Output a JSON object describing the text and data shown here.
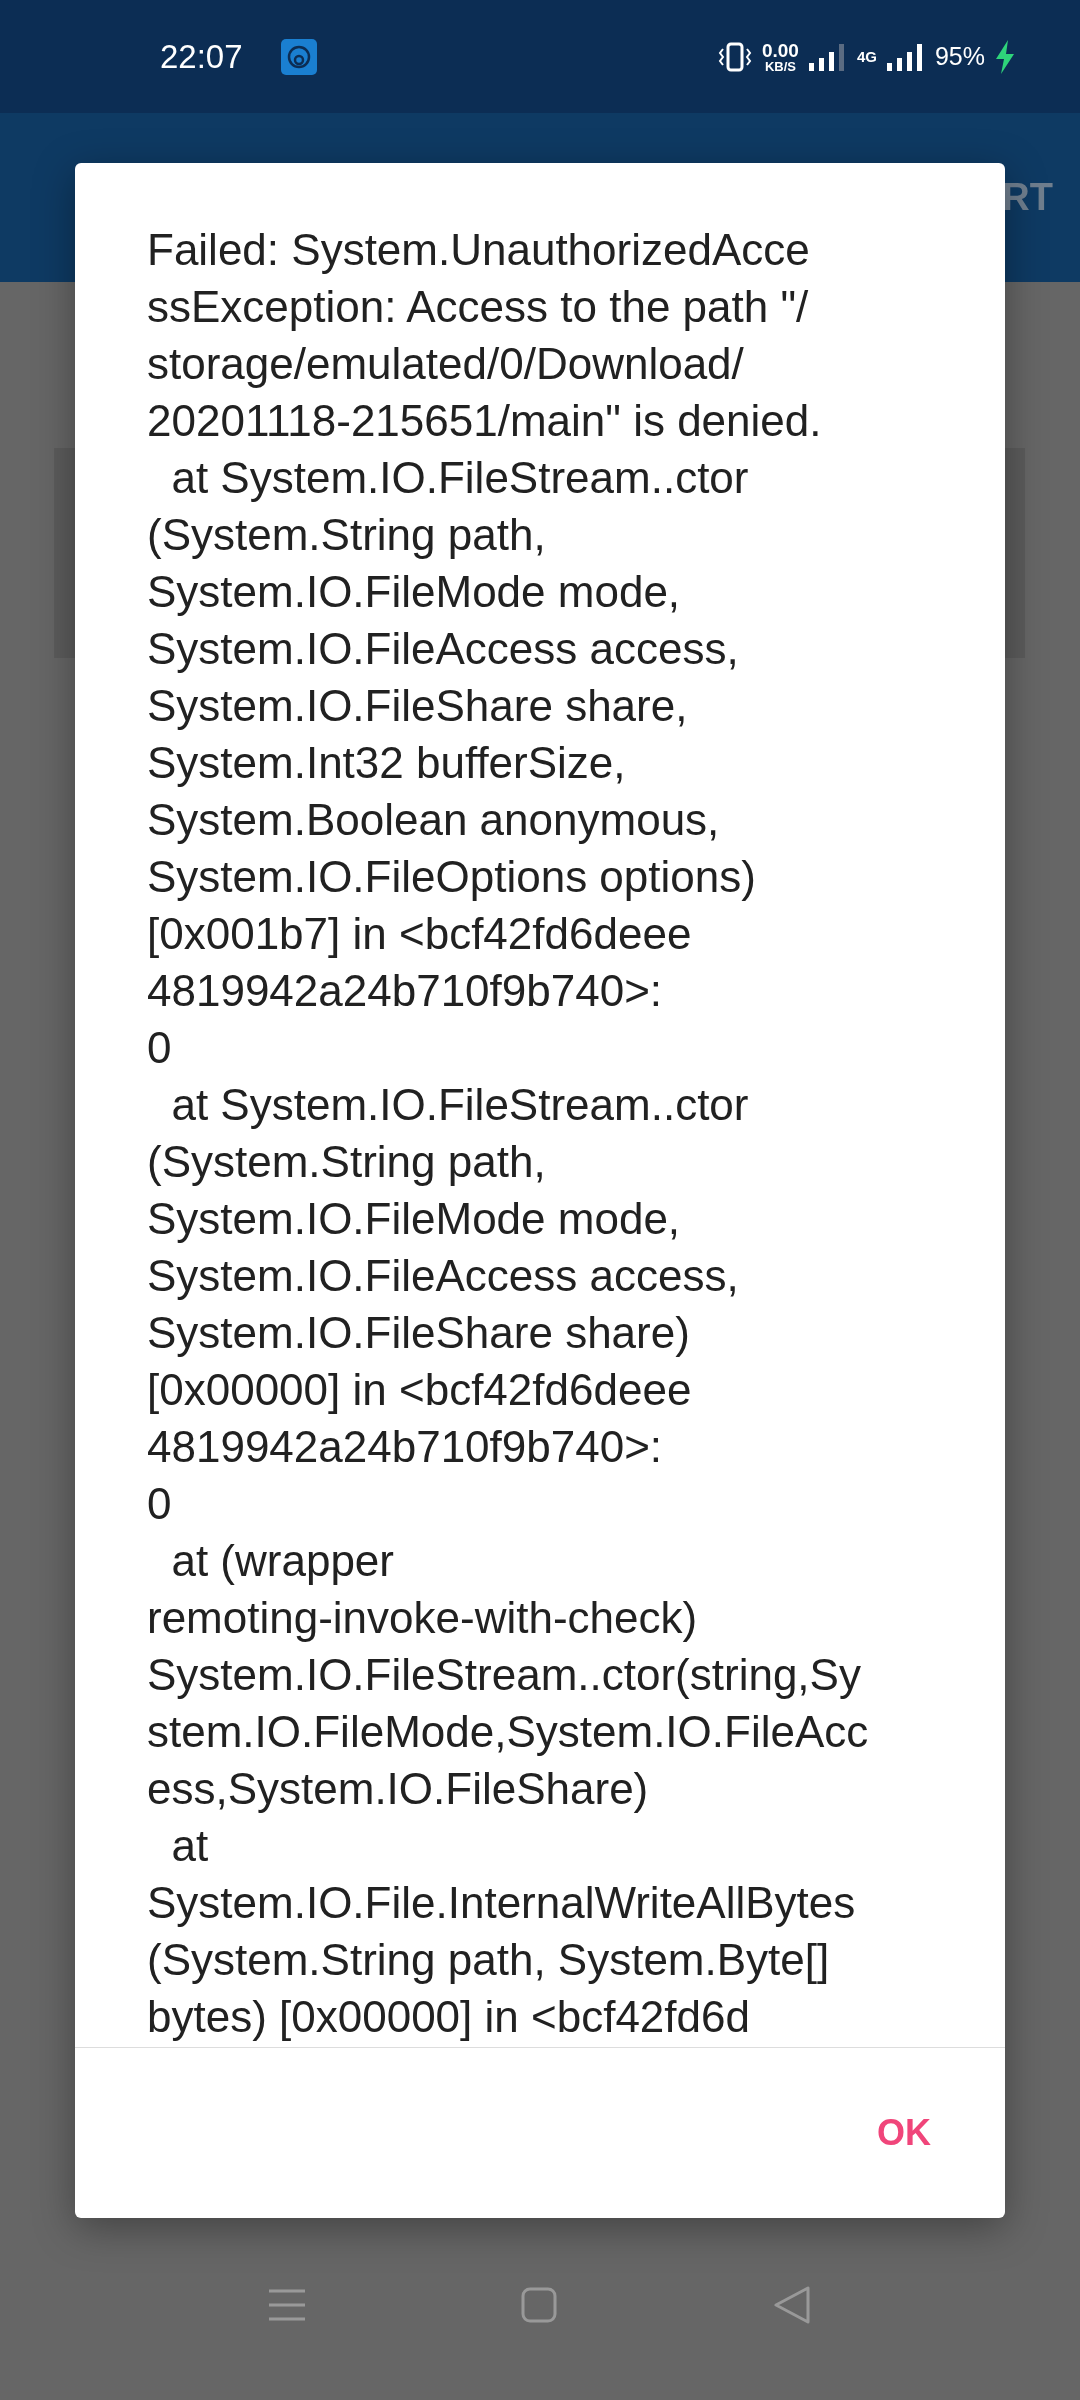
{
  "status_bar": {
    "time": "22:07",
    "net_speed": "0.00",
    "net_unit": "KB/S",
    "network_type": "4G",
    "battery": "95%"
  },
  "app_bar": {
    "action": "RT"
  },
  "dialog": {
    "message": "Failed: System.UnauthorizedAcce\nssException: Access to the path \"/\nstorage/emulated/0/Download/\n20201118-215651/main\" is denied.\n  at System.IO.FileStream..ctor\n(System.String path,\nSystem.IO.FileMode mode,\nSystem.IO.FileAccess access,\nSystem.IO.FileShare share,\nSystem.Int32 bufferSize,\nSystem.Boolean anonymous,\nSystem.IO.FileOptions options)\n[0x001b7] in <bcf42fd6deee\n4819942a24b710f9b740>:\n0\n  at System.IO.FileStream..ctor\n(System.String path,\nSystem.IO.FileMode mode,\nSystem.IO.FileAccess access,\nSystem.IO.FileShare share)\n[0x00000] in <bcf42fd6deee\n4819942a24b710f9b740>:\n0\n  at (wrapper\nremoting-invoke-with-check)\nSystem.IO.FileStream..ctor(string,Sy\nstem.IO.FileMode,System.IO.FileAcc\ness,System.IO.FileShare)\n  at\nSystem.IO.File.InternalWriteAllBytes\n(System.String path, System.Byte[]\nbytes) [0x00000] in <bcf42fd6d",
    "button": "OK"
  }
}
